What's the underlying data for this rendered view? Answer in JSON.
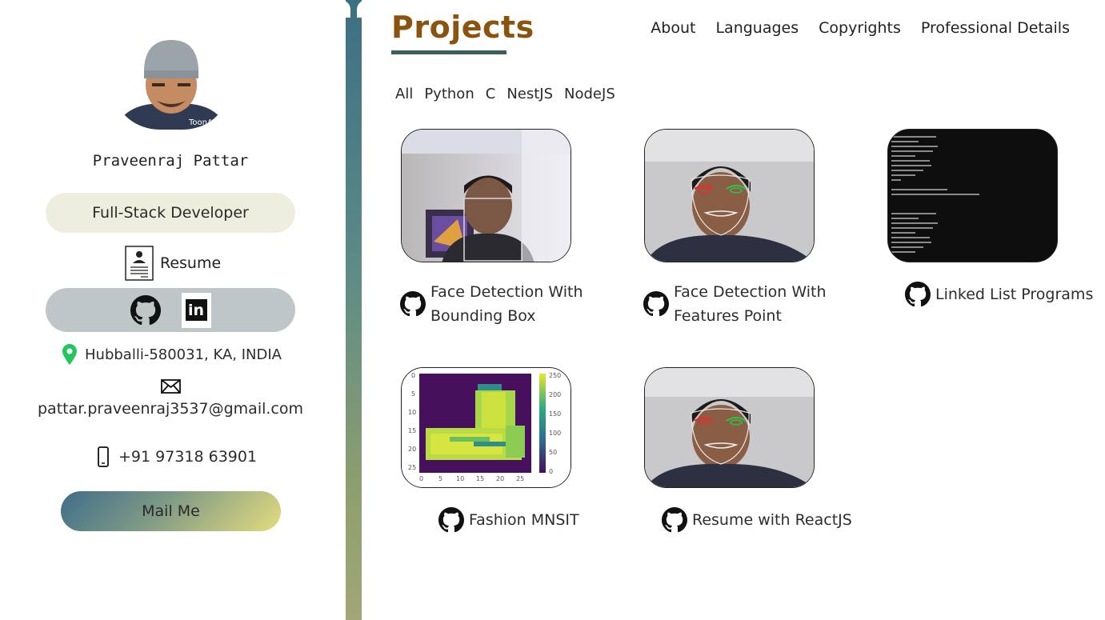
{
  "profile": {
    "name": "Praveenraj Pattar",
    "avatar_watermark": "ToonApp",
    "role": "Full-Stack Developer",
    "resume_label": "Resume",
    "location": "Hubballi-580031, KA, INDIA",
    "email": "pattar.praveenraj3537@gmail.com",
    "phone": "+91 97318 63901",
    "mail_button": "Mail Me",
    "social_icons": [
      "github-icon",
      "linkedin-icon"
    ],
    "linkedin_text": "in"
  },
  "header": {
    "title": "Projects",
    "nav": [
      "About",
      "Languages",
      "Copyrights",
      "Professional Details"
    ]
  },
  "filters": [
    "All",
    "Python",
    "C",
    "NestJS",
    "NodeJS"
  ],
  "projects": [
    {
      "title_line1": "Face Detection With",
      "title_line2": "Bounding Box",
      "icon": "github-icon"
    },
    {
      "title_line1": "Face Detection With",
      "title_line2": "Features Point",
      "icon": "github-icon"
    },
    {
      "title_line1": "Linked List Programs",
      "icon": "github-icon"
    },
    {
      "title_line1": "Fashion MNSIT",
      "icon": "github-icon"
    },
    {
      "title_line1": "Resume with ReactJS",
      "icon": "github-icon"
    }
  ],
  "colors": {
    "title": "#8a540f",
    "underline": "#3b5f5a",
    "role_pill": "#eeeedf",
    "social_pill": "#bfc6c7",
    "location_pin": "#22c55e"
  }
}
